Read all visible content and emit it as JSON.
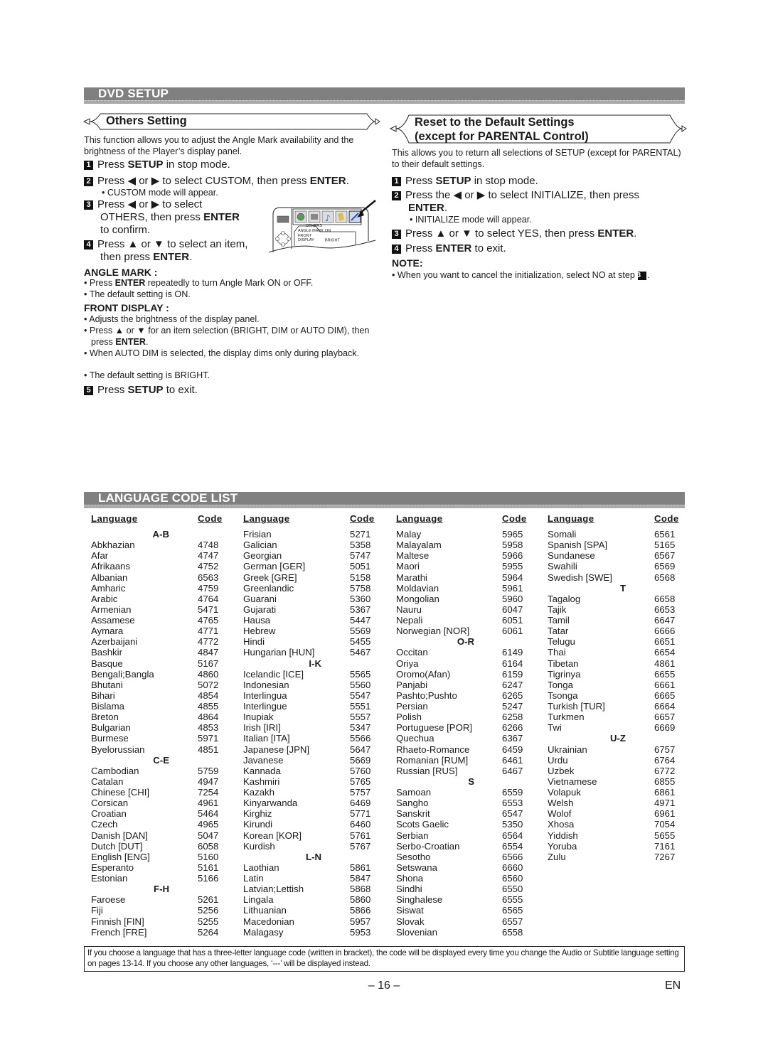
{
  "dvd_setup": {
    "title": "DVD SETUP",
    "others": {
      "heading": "Others Setting",
      "intro": "This function allows you to adjust the Angle Mark availability and the brightness of the Player’s display panel.",
      "steps": [
        {
          "num": "1",
          "pre": "Press ",
          "bold": "SETUP",
          "post": " in stop mode."
        },
        {
          "num": "2",
          "pre": "Press ◀ or ▶ to select CUSTOM, then press ",
          "bold": "ENTER",
          "post": "."
        },
        {
          "num": "3",
          "line1": "Press ◀ or ▶ to select",
          "line2_pre": "OTHERS, then press ",
          "line2_bold": "ENTER",
          "line3": "to confirm."
        },
        {
          "num": "4",
          "line1": "Press ▲ or ▼ to select an item,",
          "line2_pre": "then press ",
          "line2_bold": "ENTER",
          "line2_post": "."
        },
        {
          "num": "5",
          "pre": "Press ",
          "bold": "SETUP",
          "post": " to exit."
        }
      ],
      "step2_note": "• CUSTOM mode will appear.",
      "angle_mark": {
        "heading": "ANGLE MARK :",
        "b1_pre": "Press ",
        "b1_bold": "ENTER",
        "b1_post": " repeatedly to turn Angle Mark ON or OFF.",
        "b2": "The default setting is ON."
      },
      "front_display": {
        "heading": "FRONT DISPLAY :",
        "b1": "Adjusts the brightness of the display panel.",
        "b2_pre": "Press ▲ or ▼ for an item selection (BRIGHT, DIM or AUTO DIM), then press ",
        "b2_bold": "ENTER",
        "b2_post": ".",
        "b3": "When AUTO DIM is selected, the display dims only during playback.",
        "b4": "The default setting is BRIGHT."
      },
      "screen": {
        "tab": "OTHERS",
        "rows": [
          {
            "label": "ANGLE MARK",
            "value": "ON"
          },
          {
            "label": "FRONT DISPLAY",
            "value": "BRIGHT"
          }
        ]
      }
    },
    "reset": {
      "heading_line1": "Reset to the Default Settings",
      "heading_line2": "(except for PARENTAL Control)",
      "intro": "This allows you to return all selections of SETUP (except for PARENTAL) to their default settings.",
      "steps": [
        {
          "num": "1",
          "pre": "Press ",
          "bold": "SETUP",
          "post": " in stop mode."
        },
        {
          "num": "2",
          "line1": "Press the ◀ or ▶ to select INITIALIZE, then press",
          "line2_bold": "ENTER",
          "line2_post": "."
        },
        {
          "num": "3",
          "pre": "Press ▲ or ▼ to select YES, then press ",
          "bold": "ENTER",
          "post": "."
        },
        {
          "num": "4",
          "pre": "Press ",
          "bold": "ENTER",
          "post": " to exit."
        }
      ],
      "step2_note": "• INITIALIZE mode will appear.",
      "note_heading": "NOTE:",
      "note_pre": "When you want to cancel the initialization, select NO at step ",
      "note_num": "3",
      "note_post": "."
    }
  },
  "language_code_list": {
    "title": "LANGUAGE CODE LIST",
    "header_language": "Language",
    "header_code": "Code",
    "columns": [
      [
        {
          "g": "A-B"
        },
        {
          "n": "Abkhazian",
          "c": "4748"
        },
        {
          "n": "Afar",
          "c": "4747"
        },
        {
          "n": "Afrikaans",
          "c": "4752"
        },
        {
          "n": "Albanian",
          "c": "6563"
        },
        {
          "n": "Amharic",
          "c": "4759"
        },
        {
          "n": "Arabic",
          "c": "4764"
        },
        {
          "n": "Armenian",
          "c": "5471"
        },
        {
          "n": "Assamese",
          "c": "4765"
        },
        {
          "n": "Aymara",
          "c": "4771"
        },
        {
          "n": "Azerbaijani",
          "c": "4772"
        },
        {
          "n": "Bashkir",
          "c": "4847"
        },
        {
          "n": "Basque",
          "c": "5167"
        },
        {
          "n": "Bengali;Bangla",
          "c": "4860"
        },
        {
          "n": "Bhutani",
          "c": "5072"
        },
        {
          "n": "Bihari",
          "c": "4854"
        },
        {
          "n": "Bislama",
          "c": "4855"
        },
        {
          "n": "Breton",
          "c": "4864"
        },
        {
          "n": "Bulgarian",
          "c": "4853"
        },
        {
          "n": "Burmese",
          "c": "5971"
        },
        {
          "n": "Byelorussian",
          "c": "4851"
        },
        {
          "g": "C-E"
        },
        {
          "n": "Cambodian",
          "c": "5759"
        },
        {
          "n": "Catalan",
          "c": "4947"
        },
        {
          "n": "Chinese [CHI]",
          "c": "7254"
        },
        {
          "n": "Corsican",
          "c": "4961"
        },
        {
          "n": "Croatian",
          "c": "5464"
        },
        {
          "n": "Czech",
          "c": "4965"
        },
        {
          "n": "Danish [DAN]",
          "c": "5047"
        },
        {
          "n": "Dutch [DUT]",
          "c": "6058"
        },
        {
          "n": "English [ENG]",
          "c": "5160"
        },
        {
          "n": "Esperanto",
          "c": "5161"
        },
        {
          "n": "Estonian",
          "c": "5166"
        },
        {
          "g": "F-H"
        },
        {
          "n": "Faroese",
          "c": "5261"
        },
        {
          "n": "Fiji",
          "c": "5256"
        },
        {
          "n": "Finnish [FIN]",
          "c": "5255"
        },
        {
          "n": "French [FRE]",
          "c": "5264"
        }
      ],
      [
        {
          "n": "Frisian",
          "c": "5271"
        },
        {
          "n": "Galician",
          "c": "5358"
        },
        {
          "n": "Georgian",
          "c": "5747"
        },
        {
          "n": "German [GER]",
          "c": "5051"
        },
        {
          "n": "Greek [GRE]",
          "c": "5158"
        },
        {
          "n": "Greenlandic",
          "c": "5758"
        },
        {
          "n": "Guarani",
          "c": "5360"
        },
        {
          "n": "Gujarati",
          "c": "5367"
        },
        {
          "n": "Hausa",
          "c": "5447"
        },
        {
          "n": "Hebrew",
          "c": "5569"
        },
        {
          "n": "Hindi",
          "c": "5455"
        },
        {
          "n": "Hungarian [HUN]",
          "c": "5467"
        },
        {
          "g": "I-K"
        },
        {
          "n": "Icelandic [ICE]",
          "c": "5565"
        },
        {
          "n": "Indonesian",
          "c": "5560"
        },
        {
          "n": "Interlingua",
          "c": "5547"
        },
        {
          "n": "Interlingue",
          "c": "5551"
        },
        {
          "n": "Inupiak",
          "c": "5557"
        },
        {
          "n": "Irish [IRI]",
          "c": "5347"
        },
        {
          "n": "Italian [ITA]",
          "c": "5566"
        },
        {
          "n": "Japanese [JPN]",
          "c": "5647"
        },
        {
          "n": "Javanese",
          "c": "5669"
        },
        {
          "n": "Kannada",
          "c": "5760"
        },
        {
          "n": "Kashmiri",
          "c": "5765"
        },
        {
          "n": "Kazakh",
          "c": "5757"
        },
        {
          "n": "Kinyarwanda",
          "c": "6469"
        },
        {
          "n": "Kirghiz",
          "c": "5771"
        },
        {
          "n": "Kirundi",
          "c": "6460"
        },
        {
          "n": "Korean [KOR]",
          "c": "5761"
        },
        {
          "n": "Kurdish",
          "c": "5767"
        },
        {
          "g": "L-N"
        },
        {
          "n": "Laothian",
          "c": "5861"
        },
        {
          "n": "Latin",
          "c": "5847"
        },
        {
          "n": "Latvian;Lettish",
          "c": "5868"
        },
        {
          "n": "Lingala",
          "c": "5860"
        },
        {
          "n": "Lithuanian",
          "c": "5866"
        },
        {
          "n": "Macedonian",
          "c": "5957"
        },
        {
          "n": "Malagasy",
          "c": "5953"
        }
      ],
      [
        {
          "n": "Malay",
          "c": "5965"
        },
        {
          "n": "Malayalam",
          "c": "5958"
        },
        {
          "n": "Maltese",
          "c": "5966"
        },
        {
          "n": "Maori",
          "c": "5955"
        },
        {
          "n": "Marathi",
          "c": "5964"
        },
        {
          "n": "Moldavian",
          "c": "5961"
        },
        {
          "n": "Mongolian",
          "c": "5960"
        },
        {
          "n": "Nauru",
          "c": "6047"
        },
        {
          "n": "Nepali",
          "c": "6051"
        },
        {
          "n": "Norwegian [NOR]",
          "c": "6061"
        },
        {
          "g": "O-R"
        },
        {
          "n": "Occitan",
          "c": "6149"
        },
        {
          "n": "Oriya",
          "c": "6164"
        },
        {
          "n": "Oromo(Afan)",
          "c": "6159"
        },
        {
          "n": "Panjabi",
          "c": "6247"
        },
        {
          "n": "Pashto;Pushto",
          "c": "6265"
        },
        {
          "n": "Persian",
          "c": "5247"
        },
        {
          "n": "Polish",
          "c": "6258"
        },
        {
          "n": "Portuguese [POR]",
          "c": "6266"
        },
        {
          "n": "Quechua",
          "c": "6367"
        },
        {
          "n": "Rhaeto-Romance",
          "c": "6459"
        },
        {
          "n": "Romanian [RUM]",
          "c": "6461"
        },
        {
          "n": "Russian [RUS]",
          "c": "6467"
        },
        {
          "g": "S"
        },
        {
          "n": "Samoan",
          "c": "6559"
        },
        {
          "n": "Sangho",
          "c": "6553"
        },
        {
          "n": "Sanskrit",
          "c": "6547"
        },
        {
          "n": "Scots Gaelic",
          "c": "5350"
        },
        {
          "n": "Serbian",
          "c": "6564"
        },
        {
          "n": "Serbo-Croatian",
          "c": "6554"
        },
        {
          "n": "Sesotho",
          "c": "6566"
        },
        {
          "n": "Setswana",
          "c": "6660"
        },
        {
          "n": "Shona",
          "c": "6560"
        },
        {
          "n": "Sindhi",
          "c": "6550"
        },
        {
          "n": "Singhalese",
          "c": "6555"
        },
        {
          "n": "Siswat",
          "c": "6565"
        },
        {
          "n": "Slovak",
          "c": "6557"
        },
        {
          "n": "Slovenian",
          "c": "6558"
        }
      ],
      [
        {
          "n": "Somali",
          "c": "6561"
        },
        {
          "n": "Spanish [SPA]",
          "c": "5165"
        },
        {
          "n": "Sundanese",
          "c": "6567"
        },
        {
          "n": "Swahili",
          "c": "6569"
        },
        {
          "n": "Swedish [SWE]",
          "c": "6568"
        },
        {
          "g": "T"
        },
        {
          "n": "Tagalog",
          "c": "6658"
        },
        {
          "n": "Tajik",
          "c": "6653"
        },
        {
          "n": "Tamil",
          "c": "6647"
        },
        {
          "n": "Tatar",
          "c": "6666"
        },
        {
          "n": "Telugu",
          "c": "6651"
        },
        {
          "n": "Thai",
          "c": "6654"
        },
        {
          "n": "Tibetan",
          "c": "4861"
        },
        {
          "n": "Tigrinya",
          "c": "6655"
        },
        {
          "n": "Tonga",
          "c": "6661"
        },
        {
          "n": "Tsonga",
          "c": "6665"
        },
        {
          "n": "Turkish [TUR]",
          "c": "6664"
        },
        {
          "n": "Turkmen",
          "c": "6657"
        },
        {
          "n": "Twi",
          "c": "6669"
        },
        {
          "g": "U-Z"
        },
        {
          "n": "Ukrainian",
          "c": "6757"
        },
        {
          "n": "Urdu",
          "c": "6764"
        },
        {
          "n": "Uzbek",
          "c": "6772"
        },
        {
          "n": "Vietnamese",
          "c": "6855"
        },
        {
          "n": "Volapuk",
          "c": "6861"
        },
        {
          "n": "Welsh",
          "c": "4971"
        },
        {
          "n": "Wolof",
          "c": "6961"
        },
        {
          "n": "Xhosa",
          "c": "7054"
        },
        {
          "n": "Yiddish",
          "c": "5655"
        },
        {
          "n": "Yoruba",
          "c": "7161"
        },
        {
          "n": "Zulu",
          "c": "7267"
        }
      ]
    ],
    "footnote": "If you choose a language that has a three-letter language code (written in bracket), the code will be displayed every time you change the Audio or Subtitle language setting on pages 13-14. If you choose any other languages, ‘---’ will be displayed instead."
  },
  "footer": {
    "page_number": "– 16 –",
    "language": "EN"
  },
  "colors": {
    "section_bar": "#808080",
    "section_line": "#a9a9a9",
    "text": "#1a1a1a"
  }
}
